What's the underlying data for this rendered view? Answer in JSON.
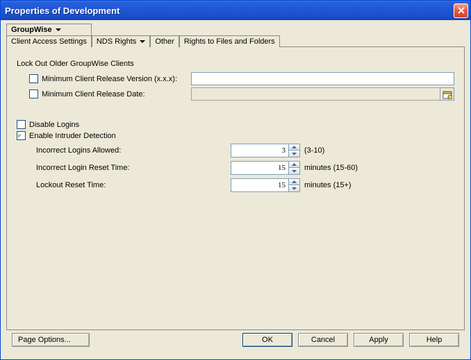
{
  "window": {
    "title": "Properties of Development"
  },
  "tabs": {
    "groupwise": {
      "label": "GroupWise",
      "sub": "Client Access Settings"
    },
    "nds": {
      "label": "NDS Rights"
    },
    "other": {
      "label": "Other"
    },
    "rights": {
      "label": "Rights to Files and Folders"
    }
  },
  "section": {
    "lockout_header": "Lock Out Older GroupWise Clients"
  },
  "fields": {
    "min_version": {
      "label": "Minimum Client Release Version (x.x.x):",
      "value": "",
      "checked": false
    },
    "min_date": {
      "label": "Minimum Client Release Date:",
      "value": "",
      "checked": false
    },
    "disable_logins": {
      "label": "Disable Logins",
      "checked": false
    },
    "enable_intruder": {
      "label": "Enable Intruder Detection",
      "checked": true
    },
    "incorrect_allowed": {
      "label": "Incorrect Logins Allowed:",
      "value": "3",
      "suffix": "(3-10)"
    },
    "incorrect_reset": {
      "label": "Incorrect Login Reset Time:",
      "value": "15",
      "suffix": "minutes (15-60)"
    },
    "lockout_reset": {
      "label": "Lockout Reset Time:",
      "value": "15",
      "suffix": "minutes (15+)"
    }
  },
  "buttons": {
    "page_options": "Page Options...",
    "ok": "OK",
    "cancel": "Cancel",
    "apply": "Apply",
    "help": "Help"
  }
}
